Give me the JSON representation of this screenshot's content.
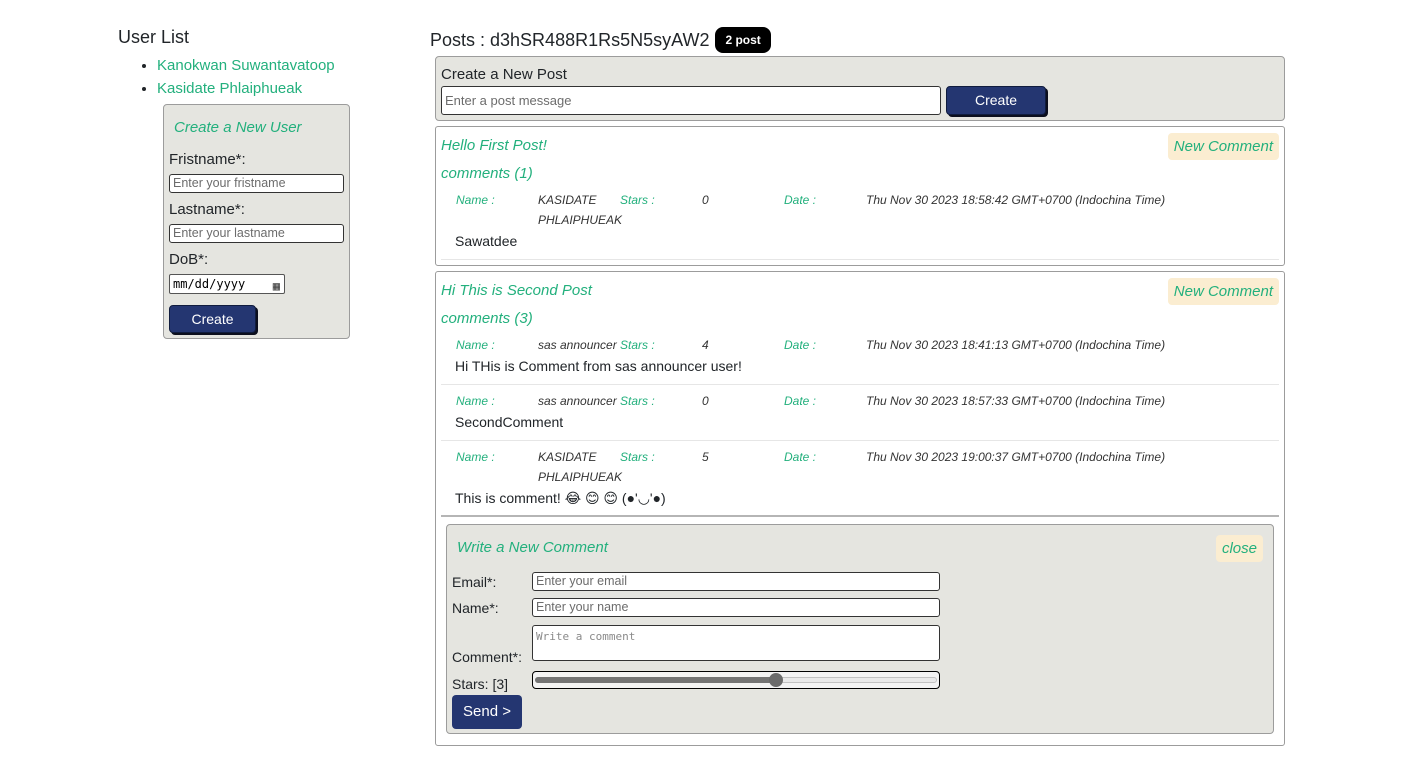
{
  "user_list": {
    "title": "User List",
    "users": [
      "Kanokwan Suwantavatoop",
      "Kasidate Phlaiphueak"
    ]
  },
  "create_user": {
    "title": "Create a New User",
    "firstname_label": "Fristname*:",
    "firstname_placeholder": "Enter your fristname",
    "lastname_label": "Lastname*:",
    "lastname_placeholder": "Enter your lastname",
    "dob_label": "DoB*:",
    "dob_placeholder": "mm/dd/yyyy",
    "button": "Create"
  },
  "posts": {
    "header": "Posts : d3hSR488R1Rs5N5syAW2",
    "badge": "2 post"
  },
  "create_post": {
    "title": "Create a New Post",
    "placeholder": "Enter a post message",
    "button": "Create"
  },
  "labels": {
    "name": "Name :",
    "stars": "Stars :",
    "date": "Date :",
    "new_comment": "New Comment"
  },
  "post_list": [
    {
      "title": "Hello First Post!",
      "comments_label": "comments (1)",
      "comments": [
        {
          "name": "KASIDATE PHLAIPHUEAK",
          "stars": "0",
          "date": "Thu Nov 30 2023 18:58:42 GMT+0700 (Indochina Time)",
          "text": "Sawatdee"
        }
      ]
    },
    {
      "title": "Hi This is Second Post",
      "comments_label": "comments (3)",
      "comments": [
        {
          "name": "sas announcer",
          "stars": "4",
          "date": "Thu Nov 30 2023 18:41:13 GMT+0700 (Indochina Time)",
          "text": "Hi THis is Comment from sas announcer user!"
        },
        {
          "name": "sas announcer",
          "stars": "0",
          "date": "Thu Nov 30 2023 18:57:33 GMT+0700 (Indochina Time)",
          "text": "SecondComment"
        },
        {
          "name": "KASIDATE PHLAIPHUEAK",
          "stars": "5",
          "date": "Thu Nov 30 2023 19:00:37 GMT+0700 (Indochina Time)",
          "text": "This is comment! 😂 😊 😊 (●'◡'●)"
        }
      ]
    }
  ],
  "comment_form": {
    "title": "Write a New Comment",
    "close": "close",
    "email_label": "Email*:",
    "email_placeholder": "Enter your email",
    "name_label": "Name*:",
    "name_placeholder": "Enter your name",
    "comment_label": "Comment*:",
    "comment_placeholder": "Write a comment",
    "stars_label": "Stars: [3]",
    "stars_value": 3,
    "stars_max": 5,
    "send": "Send >"
  },
  "colors": {
    "accent_green": "#23b07d",
    "button_navy": "#243671",
    "panel_gray": "#e5e5e0",
    "tag_cream": "#fbedd1"
  }
}
